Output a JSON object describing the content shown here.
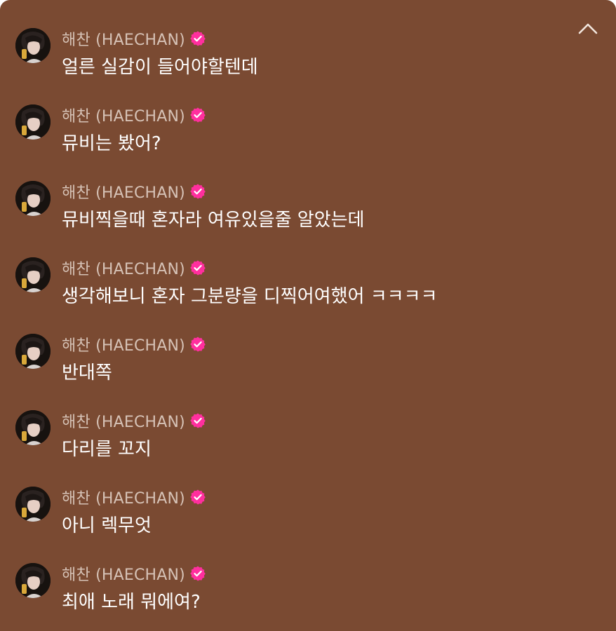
{
  "colors": {
    "panel_bg": "#7a4a32",
    "author_text": "#d6c2b6",
    "message_text": "#ffffff",
    "verified_badge": "#ff2f9e"
  },
  "header": {
    "collapse_icon": "chevron-up-icon"
  },
  "messages": [
    {
      "author": "해찬 (HAECHAN)",
      "verified": true,
      "text": "얼른 실감이 들어야할텐데"
    },
    {
      "author": "해찬 (HAECHAN)",
      "verified": true,
      "text": "뮤비는 봤어?"
    },
    {
      "author": "해찬 (HAECHAN)",
      "verified": true,
      "text": "뮤비찍을때 혼자라 여유있을줄 알았는데"
    },
    {
      "author": "해찬 (HAECHAN)",
      "verified": true,
      "text": "생각해보니 혼자 그분량을 디찍어여했어 ㅋㅋㅋㅋ"
    },
    {
      "author": "해찬 (HAECHAN)",
      "verified": true,
      "text": "반대쪽"
    },
    {
      "author": "해찬 (HAECHAN)",
      "verified": true,
      "text": "다리를 꼬지"
    },
    {
      "author": "해찬 (HAECHAN)",
      "verified": true,
      "text": "아니 렉무엇"
    },
    {
      "author": "해찬 (HAECHAN)",
      "verified": true,
      "text": "최애 노래 뭐에여?"
    }
  ]
}
